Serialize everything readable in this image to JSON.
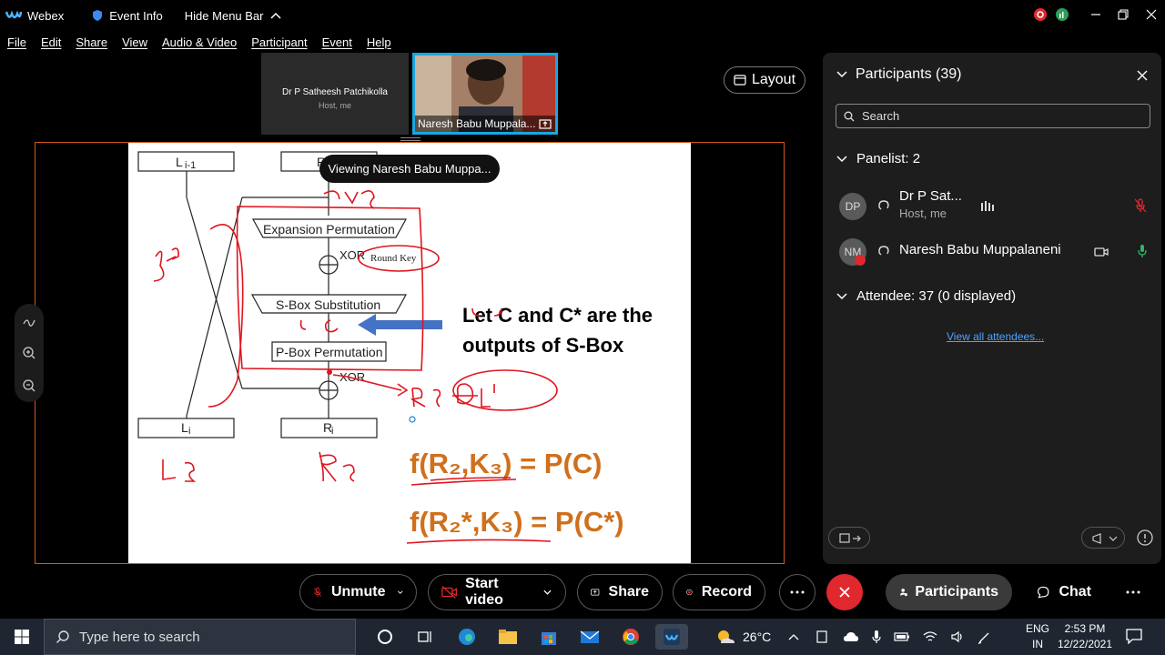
{
  "titlebar": {
    "app_name": "Webex",
    "event_info": "Event Info",
    "hide_menu": "Hide Menu Bar"
  },
  "menu": [
    "File",
    "Edit",
    "Share",
    "View",
    "Audio & Video",
    "Participant",
    "Event",
    "Help"
  ],
  "stage": {
    "thumbs": [
      {
        "name": "Dr P Satheesh Patchikolla",
        "role": "Host, me"
      },
      {
        "name": "Naresh Babu Muppala..."
      }
    ],
    "layout_label": "Layout",
    "viewing": "Viewing Naresh Babu Muppa..."
  },
  "slide": {
    "labels": {
      "l_prev": "L",
      "l_prev_sub": "i-1",
      "r_prev": "R",
      "expansion": "Expansion Permutation",
      "xor1": "XOR",
      "round_key": "Round Key",
      "sbox": "S-Box Substitution",
      "pbox": "P-Box Permutation",
      "xor2": "XOR",
      "l_i": "L",
      "l_i_sub": "i",
      "r_i": "R",
      "r_i_sub": "i"
    },
    "text_line1": "Let C and C* are the",
    "text_line2": "outputs of S-Box",
    "eq1": "f(R₂,K₃) = P(C)",
    "eq2": "f(R₂*,K₃) = P(C*)"
  },
  "panel": {
    "title": "Participants (39)",
    "search_placeholder": "Search",
    "panelist_heading": "Panelist: 2",
    "panelists": [
      {
        "initials": "DP",
        "name": "Dr P Sat...",
        "role": "Host, me"
      },
      {
        "initials": "NM",
        "name": "Naresh Babu Muppalaneni",
        "role": ""
      }
    ],
    "attendee_heading": "Attendee: 37 (0 displayed)",
    "view_all": "View all attendees..."
  },
  "controls": {
    "unmute": "Unmute",
    "start_video": "Start video",
    "share": "Share",
    "record": "Record",
    "participants": "Participants",
    "chat": "Chat"
  },
  "taskbar": {
    "search_placeholder": "Type here to search",
    "weather": "26°C",
    "lang1": "ENG",
    "lang2": "IN",
    "time": "2:53 PM",
    "date": "12/22/2021"
  },
  "colors": {
    "accent_blue": "#1aa7e0",
    "end_red": "#e0282e",
    "slide_orange": "#d0701c",
    "annotation_red": "#e0141e"
  }
}
